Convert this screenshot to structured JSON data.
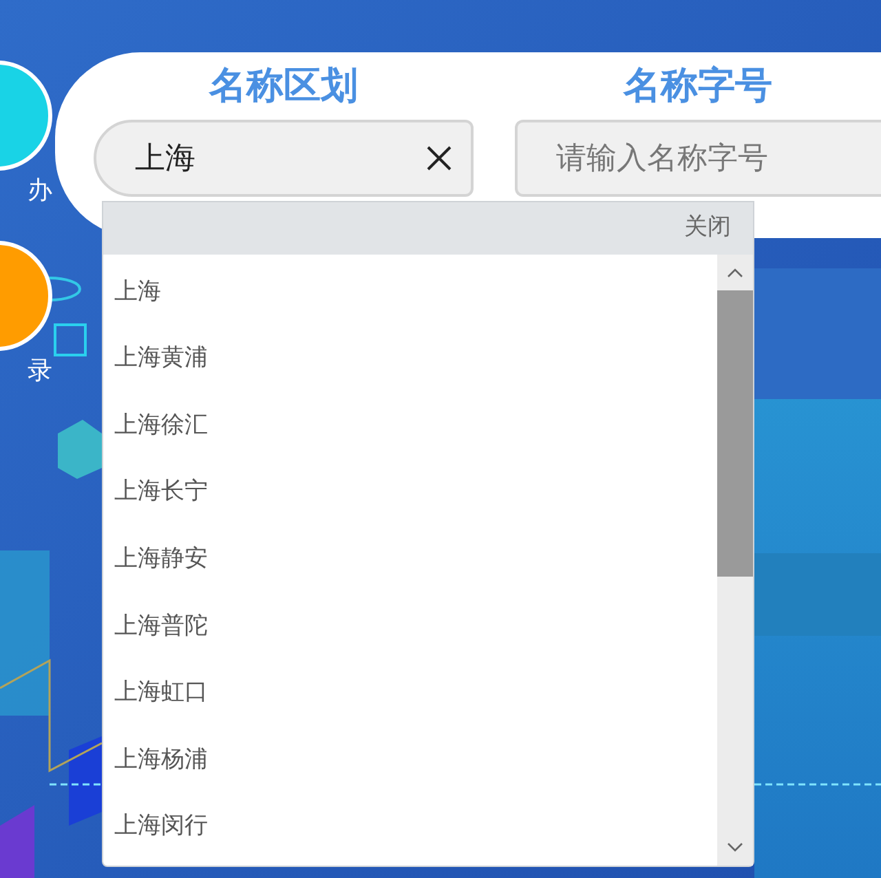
{
  "sidebar": {
    "items": [
      {
        "label": "办",
        "color": "#19d3e6"
      },
      {
        "label": "录",
        "color": "#ff9c00"
      }
    ]
  },
  "fields": [
    {
      "label": "名称区划",
      "value": "上海",
      "clearable": true
    },
    {
      "label": "名称字号",
      "placeholder": "请输入名称字号",
      "clearable": false
    }
  ],
  "dropdown": {
    "close_label": "关闭",
    "options": [
      {
        "label": "上海"
      },
      {
        "label": "上海黄浦"
      },
      {
        "label": "上海徐汇"
      },
      {
        "label": "上海长宁"
      },
      {
        "label": "上海静安"
      },
      {
        "label": "上海普陀"
      },
      {
        "label": "上海虹口"
      },
      {
        "label": "上海杨浦"
      },
      {
        "label": "上海闵行"
      }
    ]
  }
}
